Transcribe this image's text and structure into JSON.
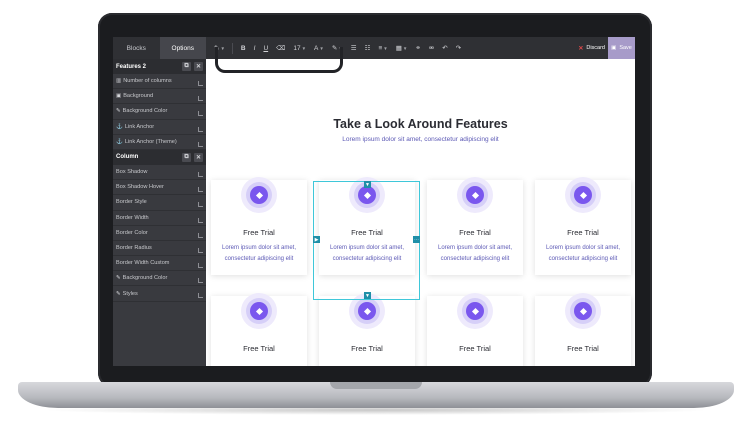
{
  "sidebar": {
    "tabs": [
      {
        "label": "Blocks",
        "active": false
      },
      {
        "label": "Options",
        "active": true
      }
    ],
    "sections": [
      {
        "title": "Features 2",
        "rows": [
          {
            "label": "Number of columns",
            "icon": "columns-icon",
            "glyph": "▥"
          },
          {
            "label": "Background",
            "icon": "image-icon",
            "glyph": "▣"
          },
          {
            "label": "Background Color",
            "icon": "eyedropper-icon",
            "glyph": "✎"
          },
          {
            "label": "Link Anchor",
            "icon": "anchor-icon",
            "glyph": "⚓"
          },
          {
            "label": "Link Anchor (Theme)",
            "icon": "anchor-icon",
            "glyph": "⚓"
          }
        ]
      },
      {
        "title": "Column",
        "rows": [
          {
            "label": "Box Shadow",
            "icon": "",
            "glyph": ""
          },
          {
            "label": "Box Shadow Hover",
            "icon": "",
            "glyph": ""
          },
          {
            "label": "Border Style",
            "icon": "",
            "glyph": ""
          },
          {
            "label": "Border Width",
            "icon": "",
            "glyph": ""
          },
          {
            "label": "Border Color",
            "icon": "",
            "glyph": ""
          },
          {
            "label": "Border Radius",
            "icon": "",
            "glyph": ""
          },
          {
            "label": "Border Width Custom",
            "icon": "",
            "glyph": ""
          },
          {
            "label": "Background Color",
            "icon": "eyedropper-icon",
            "glyph": "✎"
          },
          {
            "label": "Styles",
            "icon": "magic-wand-icon",
            "glyph": "✎"
          }
        ]
      }
    ]
  },
  "toolbar": {
    "font_size": "17",
    "discard_label": "Discard",
    "save_label": "Save"
  },
  "content": {
    "heading": "Take a Look Around Features",
    "subheading": "Lorem ipsum dolor sit amet, consectetur adipiscing elit",
    "cards": [
      {
        "title": "Free Trial",
        "desc": "Lorem ipsum dolor sit amet, consectetur adipiscing elit"
      },
      {
        "title": "Free Trial",
        "desc": "Lorem ipsum dolor sit amet, consectetur adipiscing elit"
      },
      {
        "title": "Free Trial",
        "desc": "Lorem ipsum dolor sit amet, consectetur adipiscing elit"
      },
      {
        "title": "Free Trial",
        "desc": "Lorem ipsum dolor sit amet, consectetur adipiscing elit"
      },
      {
        "title": "Free Trial",
        "desc": ""
      },
      {
        "title": "Free Trial",
        "desc": ""
      },
      {
        "title": "Free Trial",
        "desc": ""
      },
      {
        "title": "Free Trial",
        "desc": ""
      }
    ]
  },
  "colors": {
    "accent": "#7a57ee",
    "link_text": "#5c59b5",
    "selection": "#3fc7d9",
    "save_bg": "#a79bc9",
    "discard_icon": "#e0484a"
  }
}
